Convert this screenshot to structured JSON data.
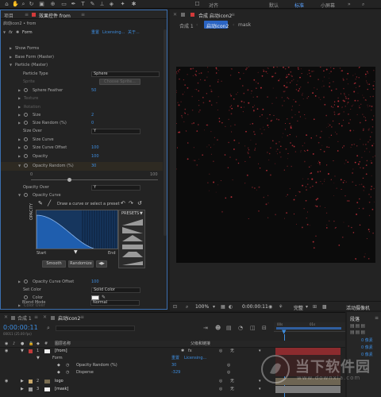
{
  "toolbar": {
    "snapping_label": "对齐",
    "workspaces": [
      "默认",
      "标准",
      "小屏幕"
    ]
  },
  "left_panel": {
    "tab_project": "项目",
    "tab_effect_controls": "效果控件 from",
    "breadcrumb": "启动icon2 • from",
    "effect": {
      "name": "Form",
      "reset_label": "重置",
      "licensing_label": "Licensing...",
      "about_label": "关于..."
    },
    "rows": {
      "show_forms": "Show Forms",
      "base_form": "Base Form (Master)",
      "particle_master": "Particle (Master)",
      "particle_type": "Particle Type",
      "particle_type_value": "Sphere",
      "sprite": "Sprite",
      "choose_sprite": "Choose Sprite...",
      "sphere_feather": "Sphere Feather",
      "sphere_feather_value": "50",
      "texture": "Texture",
      "rotation": "Rotation",
      "size": "Size",
      "size_value": "2",
      "size_random": "Size Random (%)",
      "size_random_value": "0",
      "size_over": "Size Over",
      "size_over_value": "Y",
      "size_curve": "Size Curve",
      "size_curve_offset": "Size Curve Offset",
      "size_curve_offset_value": "100",
      "opacity": "Opacity",
      "opacity_value": "100",
      "opacity_random": "Opacity Random (%)",
      "opacity_random_value": "30",
      "slider_min": "0",
      "slider_max": "100",
      "opacity_over": "Opacity Over",
      "opacity_over_value": "Y",
      "opacity_curve": "Opacity Curve",
      "curve_hint": "Draw a curve or select a preset",
      "presets_label": "PRESETS",
      "axis_opacity": "OPACITY",
      "start_label": "Start",
      "end_label": "End",
      "smooth_label": "Smooth",
      "randomize_label": "Randomize",
      "opacity_curve_offset": "Opacity Curve Offset",
      "opacity_curve_offset_value": "100",
      "set_color": "Set Color",
      "set_color_value": "Solid Color",
      "color": "Color",
      "color_over": "Color Over",
      "blend_mode": "Blend Mode",
      "blend_mode_value": "Normal"
    }
  },
  "comp_panel": {
    "title": "合成 启动icon2",
    "tab_comp1": "合成 1",
    "tab_active": "启动icon2",
    "tab_mask": "mask",
    "zoom": "100%",
    "timecode": "0:00:00:11",
    "quality": "完整",
    "camera": "活动摄像机"
  },
  "timeline": {
    "tab_comp1": "合成 1",
    "tab_active": "启动icon2",
    "timecode": "0:00:00:11",
    "frame_info": "00011 (25.00 fps)",
    "col_layer_name": "图层名称",
    "col_parent": "父级和链接",
    "layers": [
      {
        "num": "1",
        "name": "[from]",
        "parent": "无"
      },
      {
        "num": "",
        "name": "Form",
        "parent": ""
      },
      {
        "num": "",
        "name": "Opacity Random (%)",
        "value": "30",
        "parent": ""
      },
      {
        "num": "",
        "name": "Disperse",
        "value": "-329",
        "parent": ""
      },
      {
        "num": "2",
        "name": "logo",
        "parent": "无"
      },
      {
        "num": "3",
        "name": "[mask]",
        "parent": "无"
      }
    ],
    "reset_label": "重置",
    "licensing_label": "Licensing...",
    "ruler": [
      "00s",
      "01s"
    ]
  },
  "right_panel": {
    "title": "段落",
    "px_labels": [
      "0 像素",
      "0 像素",
      "0 像素"
    ]
  },
  "watermark": {
    "text": "当下软件园",
    "url_text": "www.downxia.com"
  },
  "colors": {
    "accent_blue": "#3d8de0",
    "particle_red": "#c0303a",
    "layer_red": "#8c2b2e",
    "curve_bg": "#16365e"
  }
}
